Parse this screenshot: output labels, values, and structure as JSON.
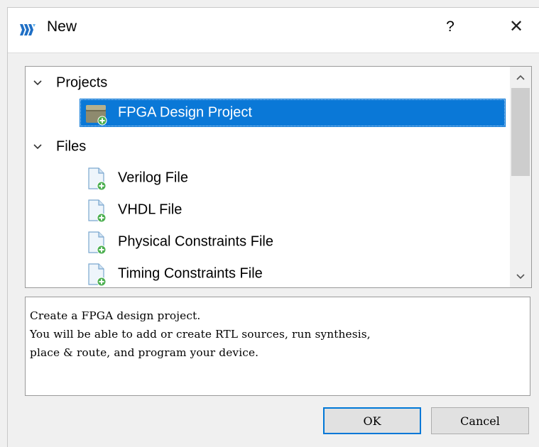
{
  "window": {
    "title": "New",
    "help_label": "?",
    "close_label": "✕"
  },
  "tree": {
    "categories": [
      {
        "label": "Projects",
        "expanded": true,
        "items": [
          {
            "label": "FPGA Design Project",
            "icon": "fpga-project-icon",
            "selected": true
          }
        ]
      },
      {
        "label": "Files",
        "expanded": true,
        "items": [
          {
            "label": "Verilog File",
            "icon": "new-file-icon"
          },
          {
            "label": "VHDL File",
            "icon": "new-file-icon"
          },
          {
            "label": "Physical Constraints File",
            "icon": "new-file-icon"
          },
          {
            "label": "Timing Constraints File",
            "icon": "new-file-icon"
          }
        ]
      }
    ]
  },
  "description": "Create a FPGA design project.\nYou will be able to add or create RTL sources, run synthesis,\nplace & route, and program your device.",
  "buttons": {
    "ok": "OK",
    "cancel": "Cancel"
  },
  "colors": {
    "selection": "#0a78d7",
    "accent": "#0078d7"
  }
}
